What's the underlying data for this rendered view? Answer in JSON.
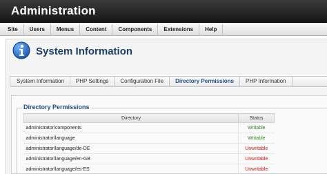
{
  "app": {
    "title": "Administration"
  },
  "menu": {
    "items": [
      "Site",
      "Users",
      "Menus",
      "Content",
      "Components",
      "Extensions",
      "Help"
    ]
  },
  "page": {
    "title": "System Information",
    "icon": "info-icon"
  },
  "tabs": {
    "items": [
      {
        "label": "System Information"
      },
      {
        "label": "PHP Settings"
      },
      {
        "label": "Configuration File"
      },
      {
        "label": "Directory Permissions"
      },
      {
        "label": "PHP Information"
      }
    ],
    "active_index": 3
  },
  "permissions": {
    "legend": "Directory Permissions",
    "columns": [
      "Directory",
      "Status"
    ],
    "rows": [
      {
        "directory": "administrator/components",
        "status": "Writable"
      },
      {
        "directory": "administrator/language",
        "status": "Writable"
      },
      {
        "directory": "administrator/language/de-DE",
        "status": "Unwritable"
      },
      {
        "directory": "administrator/language/en-GB",
        "status": "Unwritable"
      },
      {
        "directory": "administrator/language/es-ES",
        "status": "Unwritable"
      }
    ]
  },
  "colors": {
    "writable": "#2e8a20",
    "unwritable": "#cc1111",
    "title_blue": "#1a3f6b",
    "active_tab": "#1e4d8c"
  }
}
